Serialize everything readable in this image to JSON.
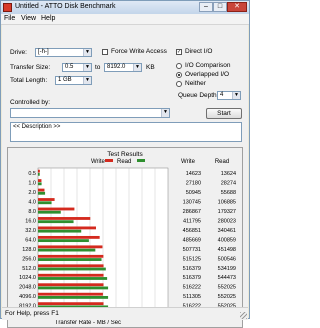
{
  "window": {
    "title": "Untitled - ATTO Disk Benchmark"
  },
  "menu": [
    "File",
    "View",
    "Help"
  ],
  "settings": {
    "drive_label": "Drive:",
    "drive_value": "[-h-]",
    "force_write_label": "Force Write Access",
    "direct_io_label": "Direct I/O",
    "transfer_label": "Transfer Size:",
    "transfer_from": "0.5",
    "to_label": "to",
    "transfer_to": "8192.0",
    "kb_label": "KB",
    "io_comparison_label": "I/O Comparison",
    "overlapped_io_label": "Overlapped I/O",
    "neither_label": "Neither",
    "total_length_label": "Total Length:",
    "total_length_value": "1 GB",
    "queue_depth_label": "Queue Depth:",
    "queue_depth_value": "4",
    "controlled_by_label": "Controlled by:",
    "start_label": "Start",
    "description": "<< Description >>"
  },
  "results": {
    "title": "Test Results",
    "legend_write": "Write",
    "legend_read": "Read",
    "col_write": "Write",
    "col_read": "Read",
    "x_label": "Transfer Rate - MB / Sec",
    "x_ticks": [
      "0",
      "100",
      "200",
      "300",
      "400",
      "500",
      "600",
      "700",
      "800",
      "900",
      "1000"
    ]
  },
  "chart_data": {
    "type": "bar",
    "title": "Test Results",
    "xlabel": "Transfer Rate - MB / Sec",
    "xlim": [
      0,
      1000
    ],
    "categories": [
      "0.5",
      "1.0",
      "2.0",
      "4.0",
      "8.0",
      "16.0",
      "32.0",
      "64.0",
      "128.0",
      "256.0",
      "512.0",
      "1024.0",
      "2048.0",
      "4096.0",
      "8192.0"
    ],
    "series": [
      {
        "name": "Write",
        "values": [
          14623,
          27180,
          50945,
          130745,
          286867,
          411795,
          456851,
          485669,
          507731,
          515125,
          516379,
          516379,
          516222,
          511305,
          516222
        ]
      },
      {
        "name": "Read",
        "values": [
          13624,
          28274,
          55688,
          106885,
          179327,
          280023,
          340461,
          400859,
          451498,
          500546,
          534199,
          544473,
          552025,
          552025,
          552025
        ]
      }
    ],
    "unit_note": "values shown in table are KB/s"
  },
  "status": {
    "text": "For Help, press F1"
  },
  "colors": {
    "write": "#d42a1e",
    "read": "#2f8f2f",
    "accent": "#7f9db9"
  }
}
